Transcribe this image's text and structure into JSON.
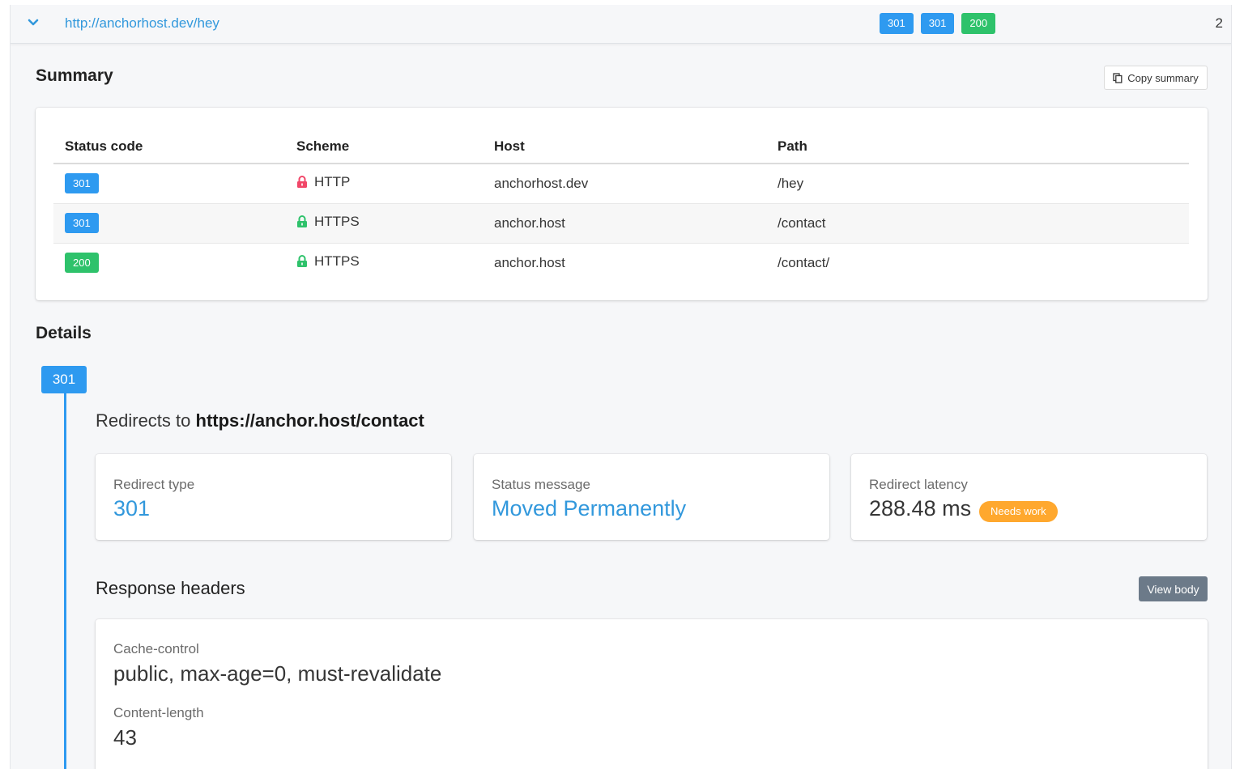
{
  "url_bar": {
    "url": "http://anchorhost.dev/hey",
    "badges": [
      {
        "label": "301",
        "color": "#2e9af0"
      },
      {
        "label": "301",
        "color": "#2e9af0"
      },
      {
        "label": "200",
        "color": "#2ec26b"
      }
    ],
    "count": "2"
  },
  "summary": {
    "title": "Summary",
    "copy_label": "Copy summary",
    "columns": [
      "Status code",
      "Scheme",
      "Host",
      "Path"
    ],
    "rows": [
      {
        "status": "301",
        "status_color": "#2e9af0",
        "scheme": "HTTP",
        "secure": false,
        "host": "anchorhost.dev",
        "path": "/hey"
      },
      {
        "status": "301",
        "status_color": "#2e9af0",
        "scheme": "HTTPS",
        "secure": true,
        "host": "anchor.host",
        "path": "/contact"
      },
      {
        "status": "200",
        "status_color": "#2ec26b",
        "scheme": "HTTPS",
        "secure": true,
        "host": "anchor.host",
        "path": "/contact/"
      }
    ]
  },
  "details": {
    "title": "Details",
    "step_badge": "301",
    "redirect_prefix": "Redirects to",
    "redirect_target": "https://anchor.host/contact",
    "stats": {
      "redirect_type_label": "Redirect type",
      "redirect_type_value": "301",
      "status_message_label": "Status message",
      "status_message_value": "Moved Permanently",
      "latency_label": "Redirect latency",
      "latency_value": "288.48 ms",
      "latency_tag": "Needs work"
    },
    "headers_title": "Response headers",
    "view_body_label": "View body",
    "headers": [
      {
        "name": "Cache-control",
        "value": "public, max-age=0, must-revalidate"
      },
      {
        "name": "Content-length",
        "value": "43"
      }
    ]
  },
  "colors": {
    "accent_blue": "#2e9af0",
    "success_green": "#2ec26b",
    "warning_orange": "#ffa82e",
    "insecure_red": "#f14668",
    "link": "#3298dc"
  }
}
